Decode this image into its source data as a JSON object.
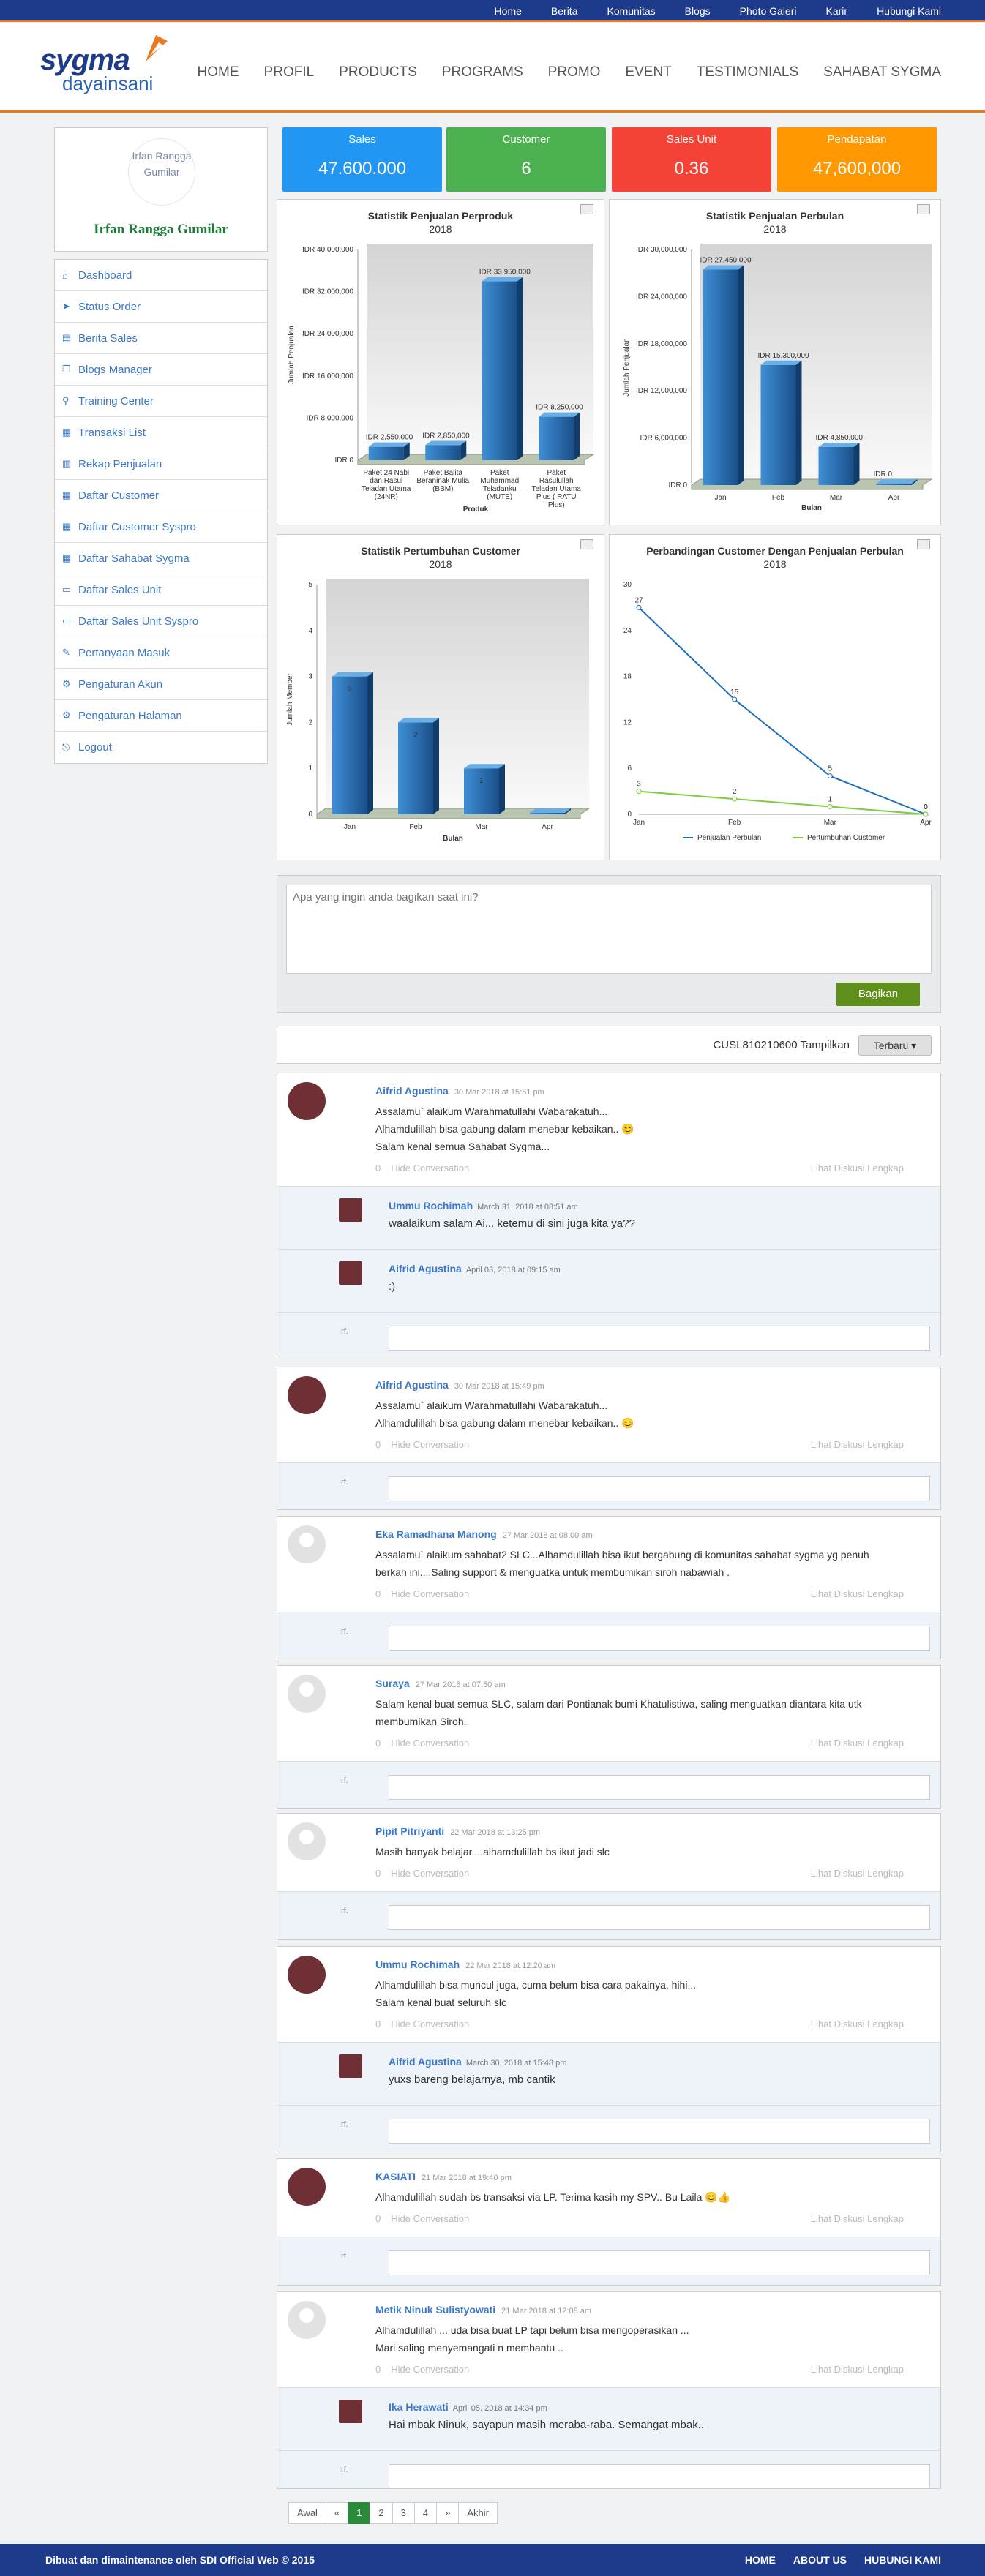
{
  "topnav": [
    "Home",
    "Berita",
    "Komunitas",
    "Blogs",
    "Photo Galeri",
    "Karir",
    "Hubungi Kami"
  ],
  "brand": {
    "name": "sygma",
    "sub": "dayainsani"
  },
  "mainnav": [
    "HOME",
    "PROFIL",
    "PRODUCTS",
    "PROGRAMS",
    "PROMO",
    "EVENT",
    "TESTIMONIALS",
    "SAHABAT SYGMA"
  ],
  "profile": {
    "avatar_alt": "Irfan Rangga Gumilar",
    "name": "Irfan Rangga Gumilar"
  },
  "menu": [
    {
      "label": "Dashboard",
      "icon": "home-icon",
      "glyph": "⌂"
    },
    {
      "label": "Status Order",
      "icon": "send-icon",
      "glyph": "➤"
    },
    {
      "label": "Berita Sales",
      "icon": "file-icon",
      "glyph": "▤"
    },
    {
      "label": "Blogs Manager",
      "icon": "copy-icon",
      "glyph": "❐"
    },
    {
      "label": "Training Center",
      "icon": "search-icon",
      "glyph": "⚲"
    },
    {
      "label": "Transaksi List",
      "icon": "cart-icon",
      "glyph": "▦"
    },
    {
      "label": "Rekap Penjualan",
      "icon": "book-icon",
      "glyph": "▥"
    },
    {
      "label": "Daftar Customer",
      "icon": "grid-icon",
      "glyph": "▦"
    },
    {
      "label": "Daftar Customer Syspro",
      "icon": "grid-icon",
      "glyph": "▦"
    },
    {
      "label": "Daftar Sahabat Sygma",
      "icon": "grid-icon",
      "glyph": "▦"
    },
    {
      "label": "Daftar Sales Unit",
      "icon": "card-icon",
      "glyph": "▭"
    },
    {
      "label": "Daftar Sales Unit Syspro",
      "icon": "card-icon",
      "glyph": "▭"
    },
    {
      "label": "Pertanyaan Masuk",
      "icon": "chat-icon",
      "glyph": "✎"
    },
    {
      "label": "Pengaturan Akun",
      "icon": "gears-icon",
      "glyph": "⚙"
    },
    {
      "label": "Pengaturan Halaman",
      "icon": "gear-icon",
      "glyph": "⚙"
    },
    {
      "label": "Logout",
      "icon": "logout-icon",
      "glyph": "⎋"
    }
  ],
  "cards": [
    {
      "title": "Sales",
      "value": "47.600.000",
      "color": "#2196f3"
    },
    {
      "title": "Customer",
      "value": "6",
      "color": "#4caf50"
    },
    {
      "title": "Sales Unit",
      "value": "0.36",
      "color": "#f44336"
    },
    {
      "title": "Pendapatan",
      "value": "47,600,000",
      "color": "#ff9800"
    }
  ],
  "chart_data": [
    {
      "type": "bar",
      "title": "Statistik Penjualan Perproduk",
      "subtitle": "2018",
      "xlabel": "Produk",
      "ylabel": "Jumlah Penjualan",
      "yticks": [
        "IDR 0",
        "IDR 8,000,000",
        "IDR 16,000,000",
        "IDR 24,000,000",
        "IDR 32,000,000",
        "IDR 40,000,000"
      ],
      "ylim": [
        0,
        40000000
      ],
      "categories": [
        [
          "Paket 24 Nabi",
          "dan Rasul",
          "Teladan Utama",
          "(24NR)"
        ],
        [
          "Paket Balita",
          "Beraninak Mulia",
          "(BBM)"
        ],
        [
          "Paket",
          "Muhammad",
          "Teladanku",
          "(MUTE)"
        ],
        [
          "Paket",
          "Rasulullah",
          "Teladan Utama",
          "Plus ( RATU",
          "Plus)"
        ]
      ],
      "values": [
        2550000,
        2850000,
        33950000,
        8250000
      ],
      "labels": [
        "IDR 2,550,000",
        "IDR 2,850,000",
        "IDR 33,950,000",
        "IDR 8,250,000"
      ]
    },
    {
      "type": "bar",
      "title": "Statistik Penjualan Perbulan",
      "subtitle": "2018",
      "xlabel": "Bulan",
      "ylabel": "Jumlah Penjualan",
      "yticks": [
        "IDR 0",
        "IDR 6,000,000",
        "IDR 12,000,000",
        "IDR 18,000,000",
        "IDR 24,000,000",
        "IDR 30,000,000"
      ],
      "ylim": [
        0,
        30000000
      ],
      "categories": [
        [
          "Jan"
        ],
        [
          "Feb"
        ],
        [
          "Mar"
        ],
        [
          "Apr"
        ]
      ],
      "values": [
        27450000,
        15300000,
        4850000,
        0
      ],
      "labels": [
        "IDR 27,450,000",
        "IDR 15,300,000",
        "IDR 4,850,000",
        "IDR 0"
      ]
    },
    {
      "type": "bar",
      "title": "Statistik Pertumbuhan Customer",
      "subtitle": "2018",
      "xlabel": "Bulan",
      "ylabel": "Jumlah Member",
      "yticks": [
        "0",
        "1",
        "2",
        "3",
        "4",
        "5"
      ],
      "ylim": [
        0,
        5
      ],
      "categories": [
        [
          "Jan"
        ],
        [
          "Feb"
        ],
        [
          "Mar"
        ],
        [
          "Apr"
        ]
      ],
      "values": [
        3,
        2,
        1,
        0
      ],
      "labels": [
        "3",
        "2",
        "1",
        ""
      ]
    },
    {
      "type": "line",
      "title": "Perbandingan Customer Dengan Penjualan Perbulan",
      "subtitle": "2018",
      "yticks": [
        "0",
        "6",
        "12",
        "18",
        "24",
        "30"
      ],
      "ylim": [
        0,
        30
      ],
      "x": [
        "Jan",
        "Feb",
        "Mar",
        "Apr"
      ],
      "series": [
        {
          "name": "Penjualan Perbulan",
          "color": "#1f6fc0",
          "values": [
            27,
            15,
            5,
            0
          ],
          "labels": [
            "27",
            "15",
            "5",
            "0"
          ]
        },
        {
          "name": "Pertumbuhan Customer",
          "color": "#7ccd3c",
          "values": [
            3,
            2,
            1,
            0
          ],
          "labels": [
            "3",
            "2",
            "1",
            "0"
          ]
        }
      ]
    }
  ],
  "share": {
    "placeholder": "Apa yang ingin anda bagikan saat ini?",
    "button": "Bagikan"
  },
  "filter": {
    "code": "CUSL810210600 Tampilkan",
    "sort": "Terbaru ▾"
  },
  "posts": [
    {
      "name": "Aifrid Agustina",
      "date": "30 Mar 2018 at 15:51 pm",
      "text": [
        "Assalamu` alaikum Warahmatullahi Wabarakatuh...",
        "Alhamdulillah bisa gabung dalam menebar kebaikan.. 😊",
        "Salam kenal semua Sahabat Sygma..."
      ],
      "replies": [
        {
          "name": "Ummu Rochimah",
          "date": "March 31, 2018 at 08:51 am",
          "text": "waalaikum salam Ai... ketemu di sini juga kita ya??"
        },
        {
          "name": "Aifrid Agustina",
          "date": "April 03, 2018 at 09:15 am",
          "text": ":)"
        }
      ]
    },
    {
      "name": "Aifrid Agustina",
      "date": "30 Mar 2018 at 15:49 pm",
      "text": [
        "Assalamu` alaikum Warahmatullahi Wabarakatuh...",
        "Alhamdulillah bisa gabung dalam menebar kebaikan.. 😊"
      ],
      "replies": []
    },
    {
      "name": "Eka Ramadhana Manong",
      "date": "27 Mar 2018 at 08:00 am",
      "text": [
        "Assalamu` alaikum sahabat2 SLC...Alhamdulillah bisa ikut bergabung di komunitas sahabat sygma yg penuh",
        "berkah ini....Saling support & menguatka untuk membumikan siroh nabawiah ."
      ],
      "replies": []
    },
    {
      "name": "Suraya",
      "date": "27 Mar 2018 at 07:50 am",
      "text": [
        "Salam kenal buat semua SLC, salam dari Pontianak bumi Khatulistiwa, saling menguatkan diantara kita utk",
        "membumikan Siroh.."
      ],
      "replies": []
    },
    {
      "name": "Pipit Pitriyanti",
      "date": "22 Mar 2018 at 13:25 pm",
      "text": [
        "Masih banyak belajar....alhamdulillah bs ikut jadi slc"
      ],
      "replies": []
    },
    {
      "name": "Ummu Rochimah",
      "date": "22 Mar 2018 at 12:20 am",
      "text": [
        "Alhamdulillah bisa muncul juga, cuma belum bisa cara pakainya, hihi...",
        "Salam kenal buat seluruh slc"
      ],
      "replies": [
        {
          "name": "Aifrid Agustina",
          "date": "March 30, 2018 at 15:48 pm",
          "text": "yuxs bareng belajarnya, mb cantik"
        }
      ]
    },
    {
      "name": "KASIATI",
      "date": "21 Mar 2018 at 19:40 pm",
      "text": [
        "Alhamdulillah sudah bs transaksi via LP. Terima kasih my SPV.. Bu Laila 😊👍"
      ],
      "replies": []
    },
    {
      "name": "Metik Ninuk Sulistyowati",
      "date": "21 Mar 2018 at 12:08 am",
      "text": [
        "Alhamdulillah ... uda bisa buat LP tapi belum bisa mengoperasikan ...",
        "Mari saling menyemangati n membantu .."
      ],
      "replies": [
        {
          "name": "Ika Herawati",
          "date": "April 05, 2018 at 14:34 pm",
          "text": "Hai mbak Ninuk, sayapun masih meraba-raba. Semangat mbak.."
        }
      ]
    }
  ],
  "post_meta": {
    "count": "0",
    "hide": "Hide Conversation",
    "more": "Lihat Diskusi Lengkap",
    "img_alt": "Irf."
  },
  "pager": [
    "Awal",
    "«",
    "1",
    "2",
    "3",
    "4",
    "»",
    "Akhir"
  ],
  "footer": {
    "text": "Dibuat dan dimaintenance oleh SDI Official Web © 2015",
    "links": [
      "HOME",
      "ABOUT US",
      "HUBUNGI KAMI"
    ]
  }
}
